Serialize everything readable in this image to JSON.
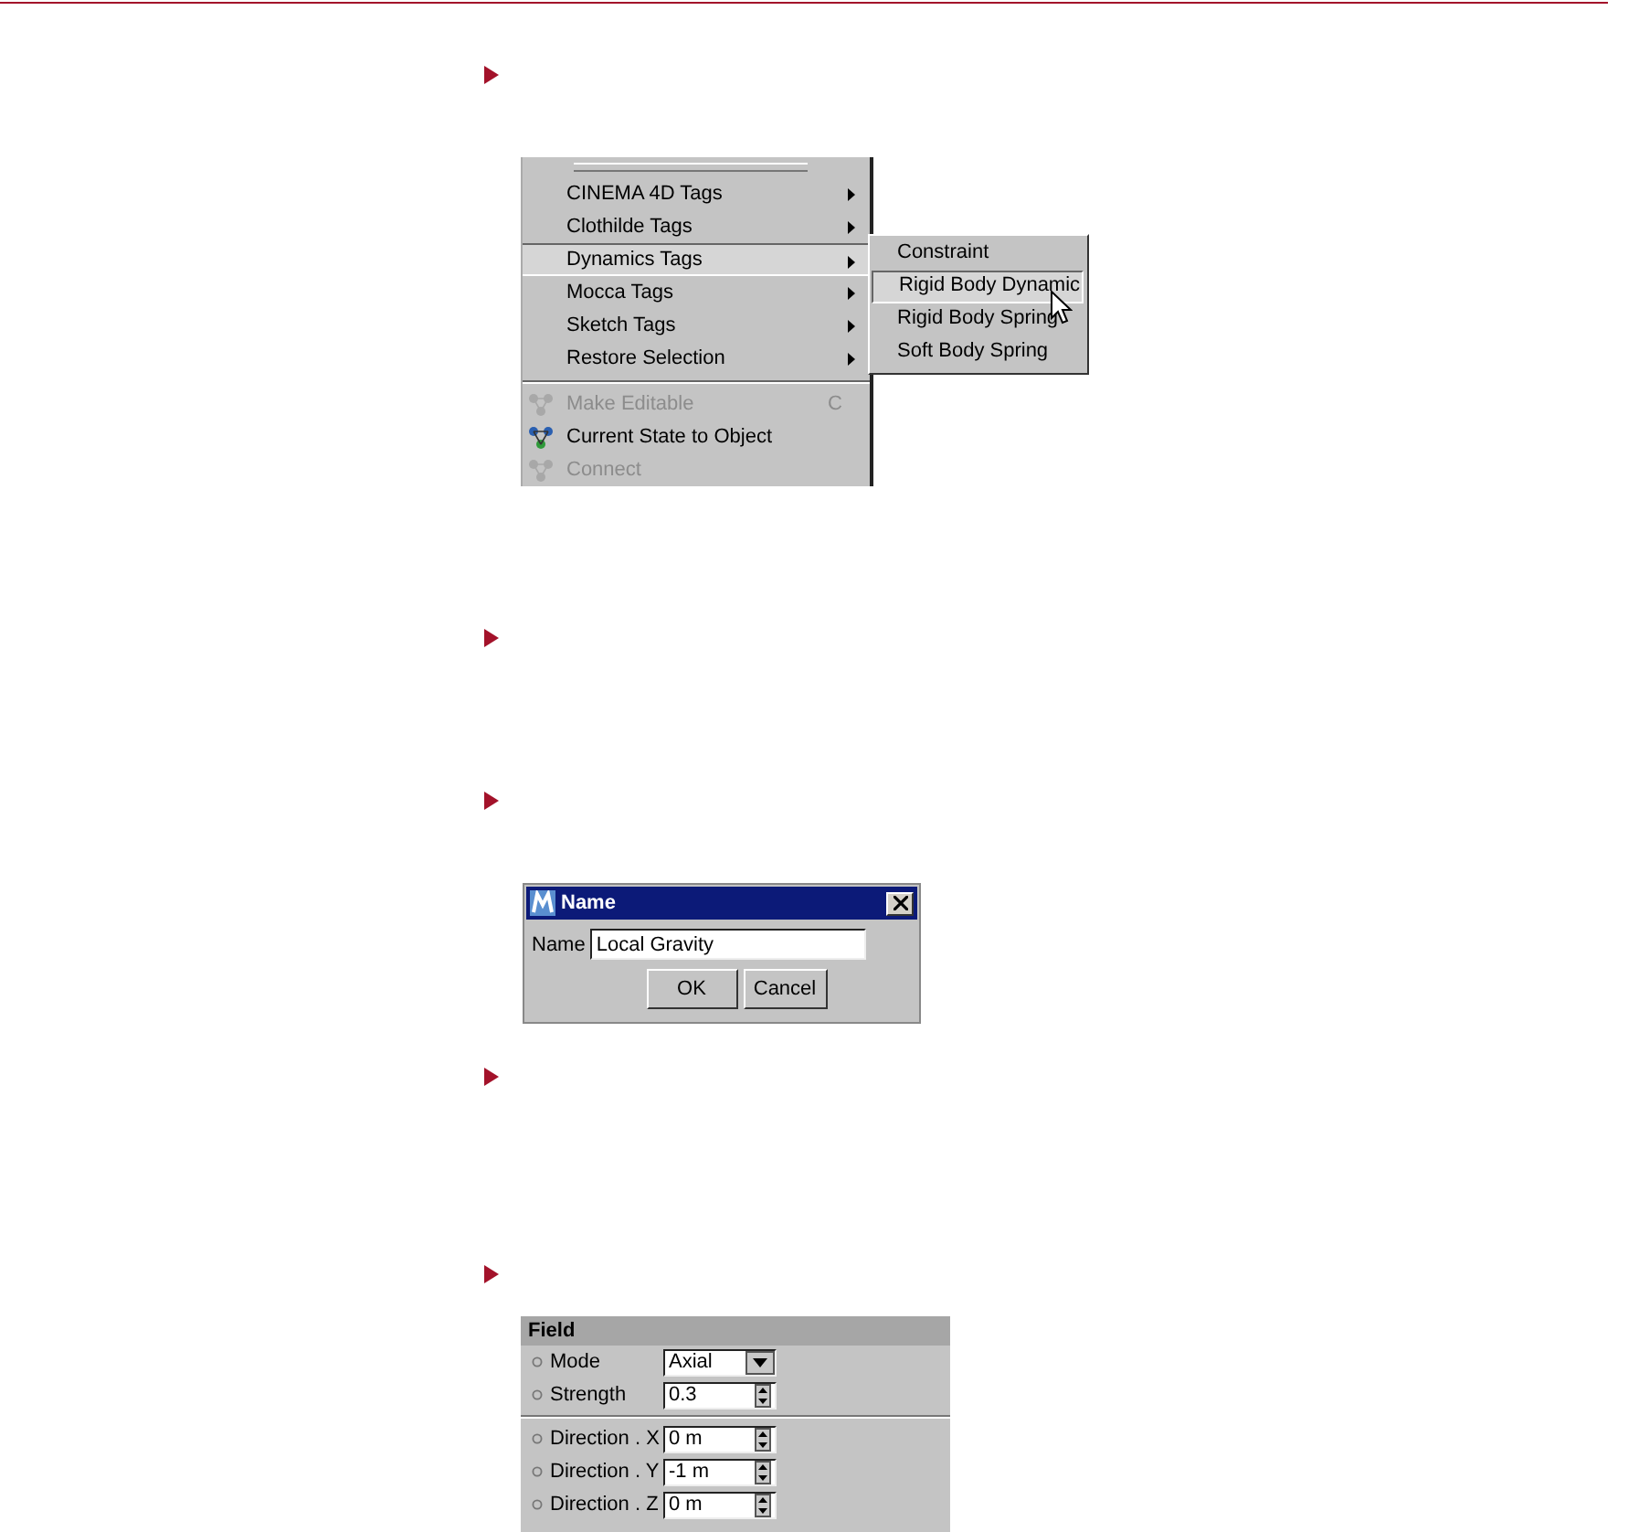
{
  "menu": {
    "items": [
      {
        "label": "CINEMA 4D Tags",
        "has_submenu": true,
        "selected": false,
        "disabled": false,
        "separator_above": false
      },
      {
        "label": "Clothilde Tags",
        "has_submenu": true,
        "selected": false,
        "disabled": false,
        "separator_above": false
      },
      {
        "label": "Dynamics Tags",
        "has_submenu": true,
        "selected": true,
        "disabled": false,
        "separator_above": false
      },
      {
        "label": "Mocca Tags",
        "has_submenu": true,
        "selected": false,
        "disabled": false,
        "separator_above": false
      },
      {
        "label": "Sketch Tags",
        "has_submenu": true,
        "selected": false,
        "disabled": false,
        "separator_above": false
      },
      {
        "label": "Restore Selection",
        "has_submenu": true,
        "selected": false,
        "disabled": false,
        "separator_above": false
      },
      {
        "label": "Make Editable",
        "shortcut": "C",
        "has_submenu": false,
        "selected": false,
        "disabled": true,
        "separator_above": true,
        "kind": "icon"
      },
      {
        "label": "Current State to Object",
        "has_submenu": false,
        "selected": false,
        "disabled": false,
        "separator_above": false,
        "kind": "icon"
      },
      {
        "label": "Connect",
        "has_submenu": false,
        "selected": false,
        "disabled": true,
        "separator_above": false,
        "kind": "icon"
      }
    ],
    "submenu": [
      {
        "label": "Constraint",
        "selected": false
      },
      {
        "label": "Rigid Body Dynamic",
        "selected": true
      },
      {
        "label": "Rigid Body Spring",
        "selected": false
      },
      {
        "label": "Soft Body Spring",
        "selected": false
      }
    ]
  },
  "dialog": {
    "title": "Name",
    "field_label": "Name",
    "value": "Local Gravity",
    "buttons": [
      "OK",
      "Cancel"
    ]
  },
  "field_panel": {
    "title": "Field",
    "rows": [
      {
        "label": "Mode",
        "kind": "dropdown",
        "value": "Axial",
        "separator_above": false
      },
      {
        "label": "Strength",
        "kind": "spinner",
        "value": "0.3",
        "separator_above": false
      },
      {
        "label": "Direction . X",
        "kind": "spinner",
        "value": "0 m",
        "separator_above": true
      },
      {
        "label": "Direction . Y",
        "kind": "spinner",
        "value": "-1 m",
        "separator_above": false
      },
      {
        "label": "Direction . Z",
        "kind": "spinner",
        "value": "0 m",
        "separator_above": false
      }
    ]
  }
}
